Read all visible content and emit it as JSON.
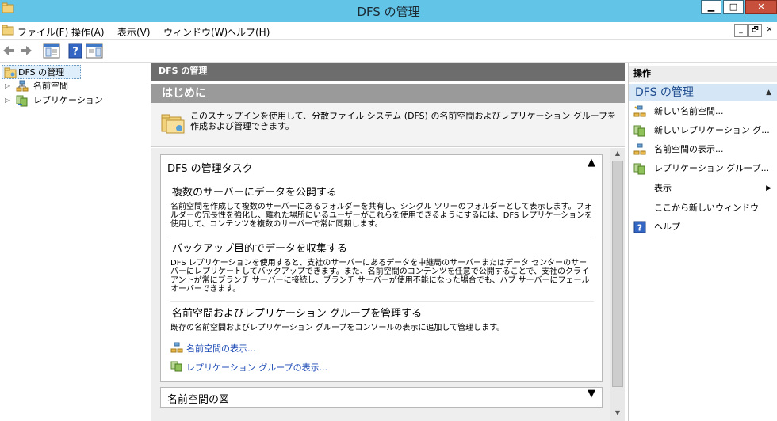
{
  "window": {
    "title": "DFS の管理",
    "minimize_glyph": "▁",
    "maximize_glyph": "□",
    "close_glyph": "✕"
  },
  "menu": {
    "items": [
      "ファイル(F)",
      "操作(A)",
      "表示(V)",
      "ウィンドウ(W)",
      "ヘルプ(H)"
    ],
    "mdi_controls": [
      "_",
      "🗗",
      "✕"
    ]
  },
  "toolbar": {
    "icons": [
      "back-arrow-icon",
      "forward-arrow-icon",
      "console-tree-icon",
      "help-icon",
      "action-pane-icon"
    ]
  },
  "tree": {
    "root": "DFS の管理",
    "children": [
      "名前空間",
      "レプリケーション"
    ]
  },
  "center": {
    "header": "DFS の管理",
    "banner": "はじめに",
    "intro": "このスナップインを使用して、分散ファイル システム (DFS) の名前空間およびレプリケーション グループを作成および管理できます。",
    "task_box_title": "DFS の管理タスク",
    "sections": [
      {
        "title": "複数のサーバーにデータを公開する",
        "body": "名前空間を作成して複数のサーバーにあるフォルダーを共有し、シングル ツリーのフォルダーとして表示します。フォルダーの冗長性を強化し、離れた場所にいるユーザーがこれらを使用できるようにするには、DFS レプリケーションを使用して、コンテンツを複数のサーバーで常に同期します。"
      },
      {
        "title": "バックアップ目的でデータを収集する",
        "body": "DFS レプリケーションを使用すると、支社のサーバーにあるデータを中継局のサーバーまたはデータ センターのサーバーにレプリケートしてバックアップできます。また、名前空間のコンテンツを任意で公開することで、支社のクライアントが常にブランチ サーバーに接続し、ブランチ サーバーが使用不能になった場合でも、ハブ サーバーにフェール オーバーできます。"
      },
      {
        "title": "名前空間およびレプリケーション グループを管理する",
        "body": "既存の名前空間およびレプリケーション グループをコンソールの表示に追加して管理します。"
      }
    ],
    "links": [
      "名前空間の表示...",
      "レプリケーション グループの表示..."
    ],
    "ns_box_title": "名前空間の図",
    "expand_up": "▲",
    "expand_down": "▼"
  },
  "actions": {
    "header": "操作",
    "group_title": "DFS の管理",
    "items": [
      {
        "label": "新しい名前空間...",
        "icon": "namespace-icon"
      },
      {
        "label": "新しいレプリケーション グ...",
        "icon": "replication-icon"
      },
      {
        "label": "名前空間の表示...",
        "icon": "namespace-icon"
      },
      {
        "label": "レプリケーション グループ...",
        "icon": "replication-icon"
      },
      {
        "label": "表示",
        "icon": "",
        "submenu": "▶"
      },
      {
        "label": "ここから新しいウィンドウ",
        "icon": ""
      },
      {
        "label": "ヘルプ",
        "icon": "help-icon"
      }
    ]
  }
}
